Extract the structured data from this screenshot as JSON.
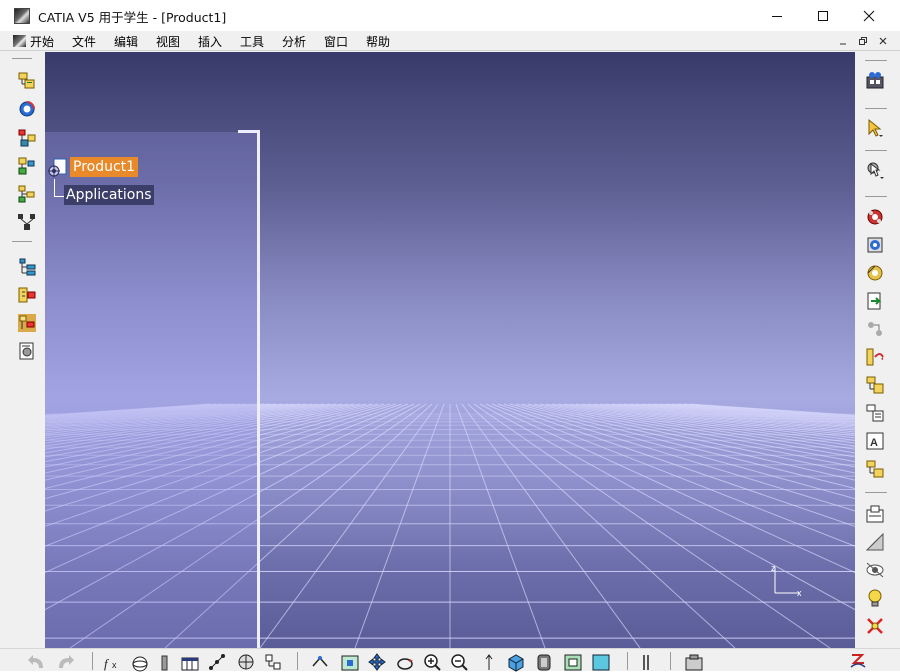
{
  "window": {
    "title": "CATIA V5 用于学生 - [Product1]",
    "controls": [
      "minimize",
      "maximize",
      "close"
    ]
  },
  "menubar": {
    "items": [
      "开始",
      "文件",
      "编辑",
      "视图",
      "插入",
      "工具",
      "分析",
      "窗口",
      "帮助"
    ]
  },
  "tree": {
    "root": {
      "label": "Product1",
      "icon": "product-icon",
      "selected": true
    },
    "children": [
      {
        "label": "Applications",
        "icon": "none"
      }
    ]
  },
  "compass": {
    "axis_z": "z",
    "axis_x": "x"
  },
  "colors": {
    "selection": "#e98a2a",
    "background_top": "#383b69",
    "background_horizon": "#a8aae2",
    "grid_lines": "#dcdcff"
  },
  "toolbars": {
    "left": [
      "specification-tree-icon",
      "catalog-icon",
      "product-structure-icon",
      "component-tree-icon",
      "generate-numbering-icon",
      "selective-load-icon",
      "manage-representations-icon",
      "multi-instantiation-icon",
      "fast-multi-instantiation-icon",
      "scenes-icon"
    ],
    "right": [
      "view-icon",
      "select-icon",
      "select-trap-icon",
      "constraint-icon",
      "fix-icon",
      "update-icon",
      "insert-existing-icon",
      "replace-icon",
      "reorder-icon",
      "publication-icon",
      "properties-icon",
      "text-icon",
      "file-tree-icon",
      "measure-icon",
      "hide-show-icon",
      "swap-icon",
      "light-icon",
      "cancel-icon"
    ],
    "bottom": [
      "undo-icon",
      "redo-icon",
      "formula-icon",
      "sphere-icon",
      "clamp-icon",
      "table-icon",
      "graph-icon",
      "snap-icon",
      "tree-expand-icon",
      "fly-icon",
      "fit-all-icon",
      "pan-icon",
      "rotate-icon",
      "zoom-in-icon",
      "zoom-out-icon",
      "normal-view-icon",
      "iso-view-icon",
      "shading-icon",
      "render-icon",
      "light-shading-icon",
      "split-icon",
      "capture-icon",
      "catia-logo-icon"
    ]
  }
}
